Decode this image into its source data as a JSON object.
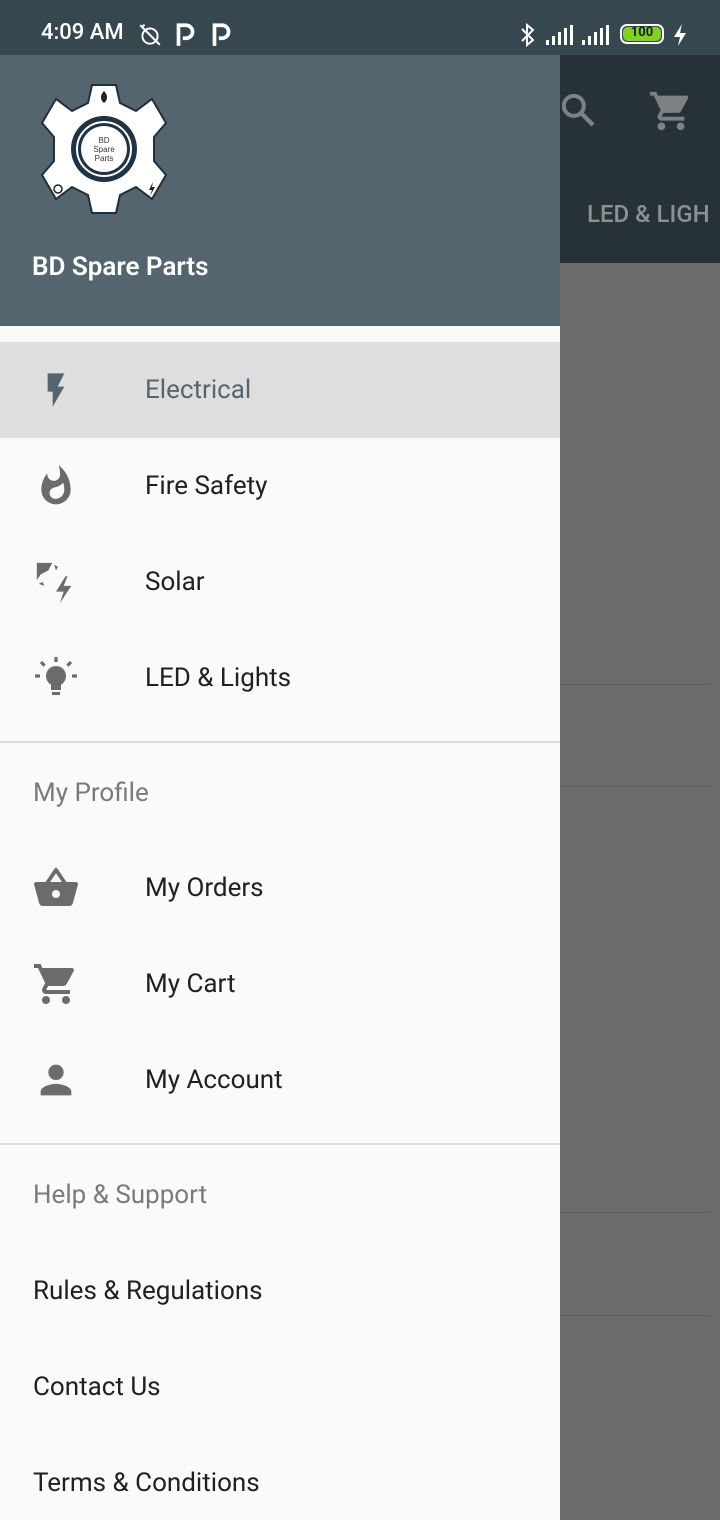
{
  "status": {
    "time": "4:09 AM",
    "battery": "100"
  },
  "background": {
    "tab_label": "LED & LIGH"
  },
  "drawer": {
    "brand": "BD Spare Parts",
    "logo_text": [
      "BD",
      "Spare",
      "Parts"
    ],
    "categories": [
      {
        "label": "Electrical",
        "icon": "bolt-icon"
      },
      {
        "label": "Fire Safety",
        "icon": "fire-icon"
      },
      {
        "label": "Solar",
        "icon": "solar-icon"
      },
      {
        "label": "LED & Lights",
        "icon": "lightbulb-icon"
      }
    ],
    "profile_section": "My Profile",
    "profile_items": [
      {
        "label": "My Orders",
        "icon": "basket-icon"
      },
      {
        "label": "My Cart",
        "icon": "cart-icon"
      },
      {
        "label": "My Account",
        "icon": "person-icon"
      }
    ],
    "help_section": "Help & Support",
    "help_items": [
      "Rules & Regulations",
      "Contact Us",
      "Terms & Conditions"
    ]
  },
  "colors": {
    "header": "#546570",
    "statusbar": "#37474f",
    "selected_bg": "#dedede",
    "app_bar": "#263238"
  }
}
